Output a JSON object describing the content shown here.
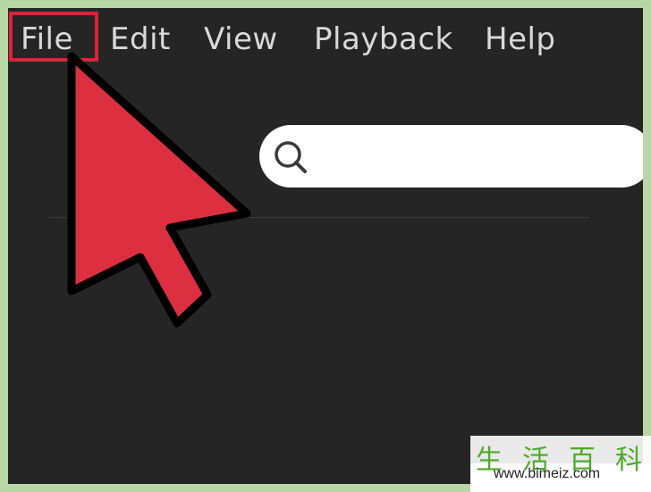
{
  "menubar": {
    "items": [
      {
        "label": "File"
      },
      {
        "label": "Edit"
      },
      {
        "label": "View"
      },
      {
        "label": "Playback"
      },
      {
        "label": "Help"
      }
    ],
    "highlighted_item": "File"
  },
  "search": {
    "placeholder": "",
    "value": ""
  },
  "watermark": {
    "chars": "生活百科",
    "url": "www.bimeiz.com"
  },
  "colors": {
    "background": "#252525",
    "menu_text": "#d9d9d9",
    "highlight": "#d8253a",
    "cursor_fill": "#dc3040",
    "frame": "#b9d6a6"
  },
  "icons": {
    "search": "search-icon",
    "pointer": "arrow-cursor-icon"
  }
}
